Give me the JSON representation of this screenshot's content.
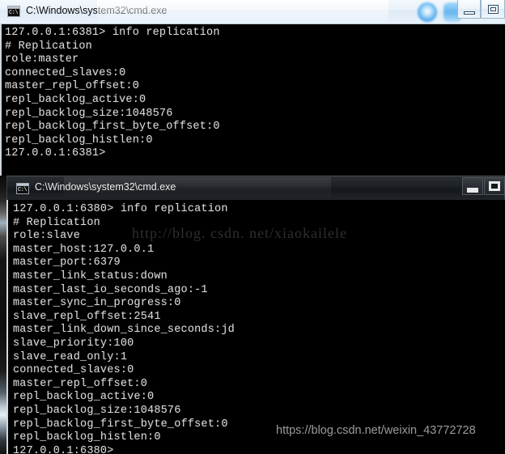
{
  "window_one": {
    "title": "C:\\Windows\\system32\\cmd.exe",
    "icon": "cmd-console-icon",
    "state": "inactive",
    "controls": {
      "minimize_label": "Minimize",
      "restore_label": "Restore"
    },
    "console_text": "127.0.0.1:6381> info replication\n# Replication\nrole:master\nconnected_slaves:0\nmaster_repl_offset:0\nrepl_backlog_active:0\nrepl_backlog_size:1048576\nrepl_backlog_first_byte_offset:0\nrepl_backlog_histlen:0\n127.0.0.1:6381>",
    "console_lines": [
      "127.0.0.1:6381> info replication",
      "# Replication",
      "role:master",
      "connected_slaves:0",
      "master_repl_offset:0",
      "repl_backlog_active:0",
      "repl_backlog_size:1048576",
      "repl_backlog_first_byte_offset:0",
      "repl_backlog_histlen:0",
      "127.0.0.1:6381>"
    ],
    "prompt": "127.0.0.1:6381>",
    "command": "info replication"
  },
  "window_two": {
    "title": "C:\\Windows\\system32\\cmd.exe",
    "icon": "cmd-console-icon",
    "state": "active",
    "controls": {
      "minimize_label": "Minimize",
      "restore_label": "Restore"
    },
    "console_text": "127.0.0.1:6380> info replication\n# Replication\nrole:slave\nmaster_host:127.0.0.1\nmaster_port:6379\nmaster_link_status:down\nmaster_last_io_seconds_ago:-1\nmaster_sync_in_progress:0\nslave_repl_offset:2541\nmaster_link_down_since_seconds:jd\nslave_priority:100\nslave_read_only:1\nconnected_slaves:0\nmaster_repl_offset:0\nrepl_backlog_active:0\nrepl_backlog_size:1048576\nrepl_backlog_first_byte_offset:0\nrepl_backlog_histlen:0\n127.0.0.1:6380>",
    "console_lines": [
      "127.0.0.1:6380> info replication",
      "# Replication",
      "role:slave",
      "master_host:127.0.0.1",
      "master_port:6379",
      "master_link_status:down",
      "master_last_io_seconds_ago:-1",
      "master_sync_in_progress:0",
      "slave_repl_offset:2541",
      "master_link_down_since_seconds:jd",
      "slave_priority:100",
      "slave_read_only:1",
      "connected_slaves:0",
      "master_repl_offset:0",
      "repl_backlog_active:0",
      "repl_backlog_size:1048576",
      "repl_backlog_first_byte_offset:0",
      "repl_backlog_histlen:0",
      "127.0.0.1:6380>"
    ],
    "prompt": "127.0.0.1:6380>",
    "command": "info replication"
  },
  "watermarks": {
    "serif": "http://blog. csdn. net/xiaokailele",
    "sans": "https://blog.csdn.net/weixin_43772728"
  },
  "colors": {
    "console_background": "#000000",
    "console_text": "#d9d9d9",
    "titlebar_inactive": "#e9f2fb",
    "titlebar_active": "#1c1f23",
    "watermark_dim": "#2f2f2f",
    "watermark_grey": "#9b9b9b"
  }
}
